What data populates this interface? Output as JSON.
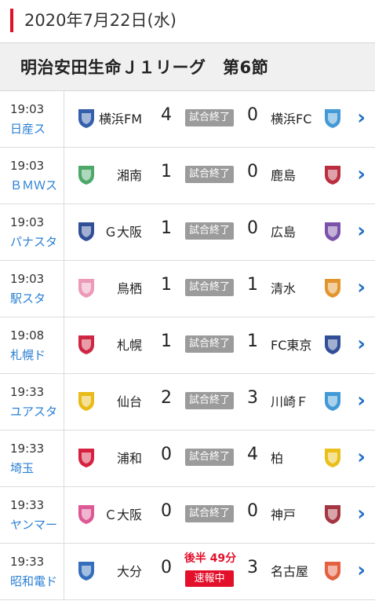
{
  "header": {
    "date": "2020年7月22日(水)"
  },
  "league": {
    "title": "明治安田生命Ｊ１リーグ　第6節"
  },
  "colors": {
    "accent": "#e3102b",
    "venue_link": "#2a7fd4",
    "status_grey": "#9b9b9b",
    "chevron": "#1f6fc5"
  },
  "matches": [
    {
      "time": "19:03",
      "venue": "日産ス",
      "home": "横浜FM",
      "home_score": "4",
      "status": "試合終了",
      "away_score": "0",
      "away": "横浜FC",
      "home_emblem": "yokohama-fm-emblem",
      "away_emblem": "yokohama-fc-emblem",
      "home_color": "#1e4ea3",
      "away_color": "#2f8fd1"
    },
    {
      "time": "19:03",
      "venue": "ＢＭＷス",
      "home": "湘南",
      "home_score": "1",
      "status": "試合終了",
      "away_score": "0",
      "away": "鹿島",
      "home_emblem": "shonan-emblem",
      "away_emblem": "kashima-emblem",
      "home_color": "#3a9f5a",
      "away_color": "#b2172b"
    },
    {
      "time": "19:03",
      "venue": "パナスタ",
      "home": "Ｇ大阪",
      "home_score": "1",
      "status": "試合終了",
      "away_score": "0",
      "away": "広島",
      "home_emblem": "gamba-emblem",
      "away_emblem": "hiroshima-emblem",
      "home_color": "#1a3c8c",
      "away_color": "#6b3fa0"
    },
    {
      "time": "19:03",
      "venue": "駅スタ",
      "home": "鳥栖",
      "home_score": "1",
      "status": "試合終了",
      "away_score": "1",
      "away": "清水",
      "home_emblem": "tosu-emblem",
      "away_emblem": "shimizu-emblem",
      "home_color": "#e98fb0",
      "away_color": "#e08a16"
    },
    {
      "time": "19:08",
      "venue": "札幌ド",
      "home": "札幌",
      "home_score": "1",
      "status": "試合終了",
      "away_score": "1",
      "away": "FC東京",
      "home_emblem": "sapporo-emblem",
      "away_emblem": "fc-tokyo-emblem",
      "home_color": "#c8102e",
      "away_color": "#1a3c8c"
    },
    {
      "time": "19:33",
      "venue": "ユアスタ",
      "home": "仙台",
      "home_score": "2",
      "status": "試合終了",
      "away_score": "3",
      "away": "川崎Ｆ",
      "home_emblem": "sendai-emblem",
      "away_emblem": "kawasaki-emblem",
      "home_color": "#e6b400",
      "away_color": "#2c8ed0"
    },
    {
      "time": "19:33",
      "venue": "埼玉",
      "home": "浦和",
      "home_score": "0",
      "status": "試合終了",
      "away_score": "4",
      "away": "柏",
      "home_emblem": "urawa-emblem",
      "away_emblem": "kashiwa-emblem",
      "home_color": "#d10a2c",
      "away_color": "#e8b800"
    },
    {
      "time": "19:33",
      "venue": "ヤンマー",
      "home": "Ｃ大阪",
      "home_score": "0",
      "status": "試合終了",
      "away_score": "0",
      "away": "神戸",
      "home_emblem": "cerezo-emblem",
      "away_emblem": "kobe-emblem",
      "home_color": "#d9478a",
      "away_color": "#9a1f2e"
    },
    {
      "time": "19:33",
      "venue": "昭和電ド",
      "home": "大分",
      "home_score": "0",
      "status": "速報中",
      "half": "後半 49分",
      "away_score": "3",
      "away": "名古屋",
      "home_emblem": "oita-emblem",
      "away_emblem": "nagoya-emblem",
      "home_color": "#1f5fb5",
      "away_color": "#e0502a"
    }
  ]
}
